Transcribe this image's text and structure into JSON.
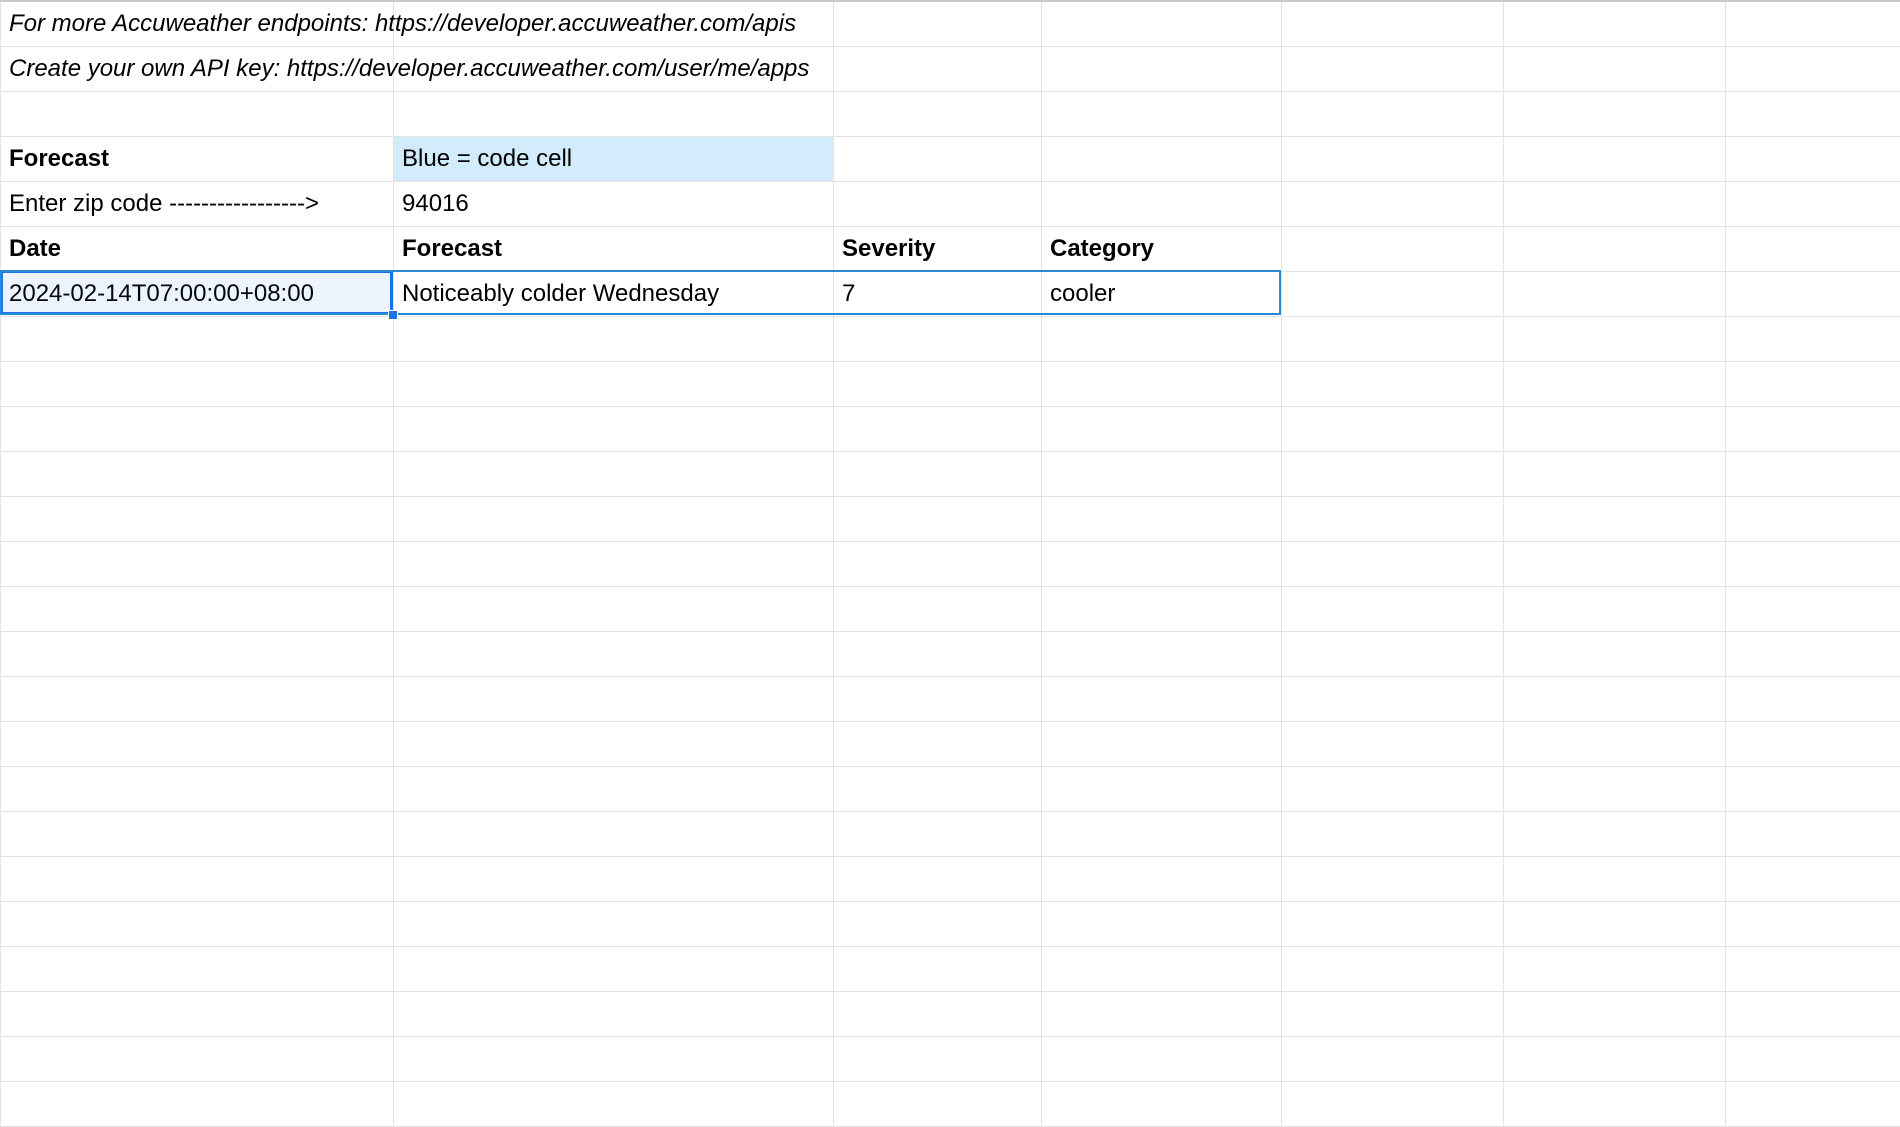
{
  "info": {
    "endpoints_note": "For more Accuweather endpoints: https://developer.accuweather.com/apis",
    "apikey_note": "Create your own API key: https://developer.accuweather.com/user/me/apps"
  },
  "labels": {
    "forecast_header": "Forecast",
    "code_cell_legend": "Blue = code cell",
    "enter_zip": "Enter zip code ----------------->",
    "col_date": "Date",
    "col_forecast": "Forecast",
    "col_severity": "Severity",
    "col_category": "Category"
  },
  "inputs": {
    "zip_code": "94016"
  },
  "rows": [
    {
      "date": "2024-02-14T07:00:00+08:00",
      "forecast": "Noticeably colder Wednesday",
      "severity": "7",
      "category": "cooler"
    }
  ]
}
